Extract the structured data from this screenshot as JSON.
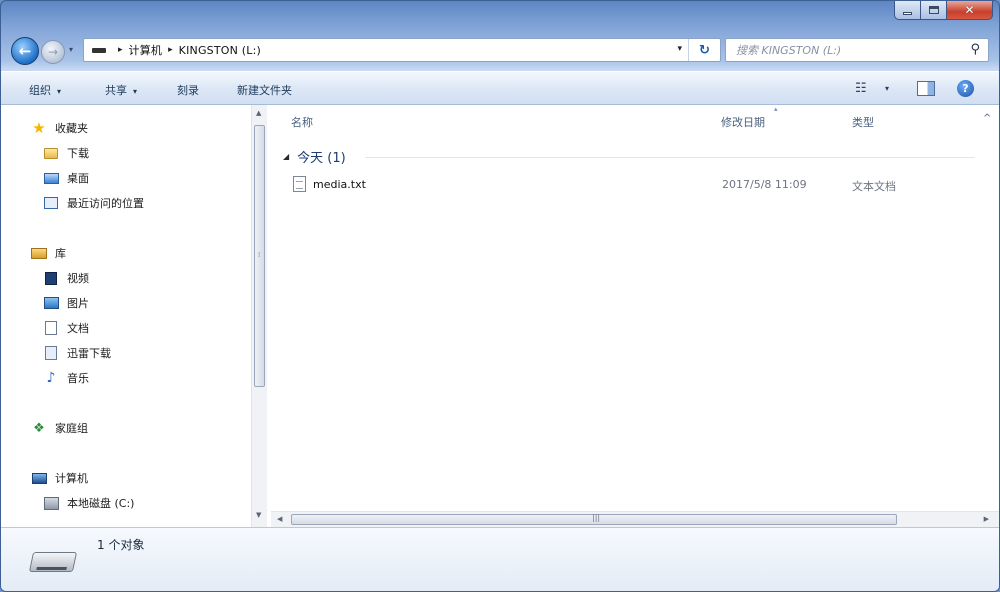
{
  "window": {
    "caption": {
      "minimize": "▁",
      "maximize": "□",
      "close": "✕"
    }
  },
  "navigation": {
    "back_glyph": "←",
    "forward_glyph": "→",
    "recent_glyph": "▾",
    "breadcrumb": [
      "计算机",
      "KINGSTON (L:)"
    ],
    "breadcrumb_sep": "▸",
    "dropdown_glyph": "▾",
    "refresh_glyph": "↻",
    "search_placeholder": "搜索 KINGSTON (L:)",
    "search_glyph": "⚲"
  },
  "toolbar": {
    "organize": "组织",
    "share": "共享",
    "burn": "刻录",
    "new_folder": "新建文件夹",
    "arrow": "▾",
    "view_glyph": "☷",
    "help_glyph": "?"
  },
  "sidebar": {
    "favorites": {
      "label": "收藏夹",
      "items": [
        "下载",
        "桌面",
        "最近访问的位置"
      ]
    },
    "libraries": {
      "label": "库",
      "items": [
        "视频",
        "图片",
        "文档",
        "迅雷下载",
        "音乐"
      ]
    },
    "homegroup": {
      "label": "家庭组"
    },
    "computer": {
      "label": "计算机",
      "items": [
        "本地磁盘 (C:)"
      ]
    },
    "icons": {
      "star": "★",
      "music": "♪",
      "home": "❖"
    }
  },
  "content": {
    "columns": {
      "name": "名称",
      "date": "修改日期",
      "type": "类型"
    },
    "column_more": "^",
    "sort_glyph": "▴",
    "group": {
      "label": "今天 (1)",
      "glyph": "◢"
    },
    "files": [
      {
        "name": "media.txt",
        "date": "2017/5/8 11:09",
        "type": "文本文档"
      }
    ]
  },
  "scrollbars": {
    "up": "▲",
    "down": "▼",
    "left": "◀",
    "right": "▶",
    "grip": "⁞",
    "hgrip": "|||"
  },
  "details": {
    "count": "1 个对象"
  }
}
